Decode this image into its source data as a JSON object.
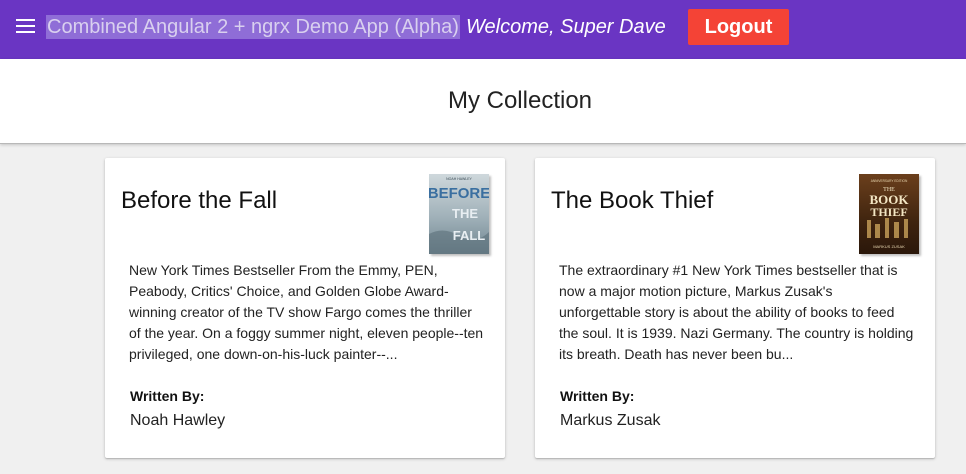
{
  "toolbar": {
    "title": "Combined Angular 2 + ngrx Demo App (Alpha)",
    "welcome": "Welcome, Super Dave",
    "logout_label": "Logout",
    "menu_icon": "menu-icon"
  },
  "page": {
    "title": "My Collection"
  },
  "books": [
    {
      "title": "Before the Fall",
      "description": "New York Times Bestseller From the Emmy, PEN, Peabody, Critics' Choice, and Golden Globe Award-winning creator of the TV show Fargo comes the thriller of the year. On a foggy summer night, eleven people--ten privileged, one down-on-his-luck painter--...",
      "written_by_label": "Written By:",
      "author": "Noah Hawley",
      "cover": {
        "top_text": "NOAH HAWLEY",
        "line1": "BEFORE",
        "line2": "THE",
        "line3": "FALL"
      }
    },
    {
      "title": "The Book Thief",
      "description": "The extraordinary #1 New York Times bestseller that is now a major motion picture, Markus Zusak's unforgettable story is about the ability of books to feed the soul. It is 1939. Nazi Germany. The country is holding its breath. Death has never been bu...",
      "written_by_label": "Written By:",
      "author": "Markus Zusak",
      "cover": {
        "top_text": "ANNIVERSARY EDITION",
        "line1": "THE",
        "line2": "BOOK",
        "line3": "THIEF",
        "bottom_text": "MARKUS ZUSAK"
      }
    }
  ],
  "colors": {
    "toolbar": "#6a35c3",
    "logout": "#f44336",
    "background": "#f0f0f0"
  }
}
